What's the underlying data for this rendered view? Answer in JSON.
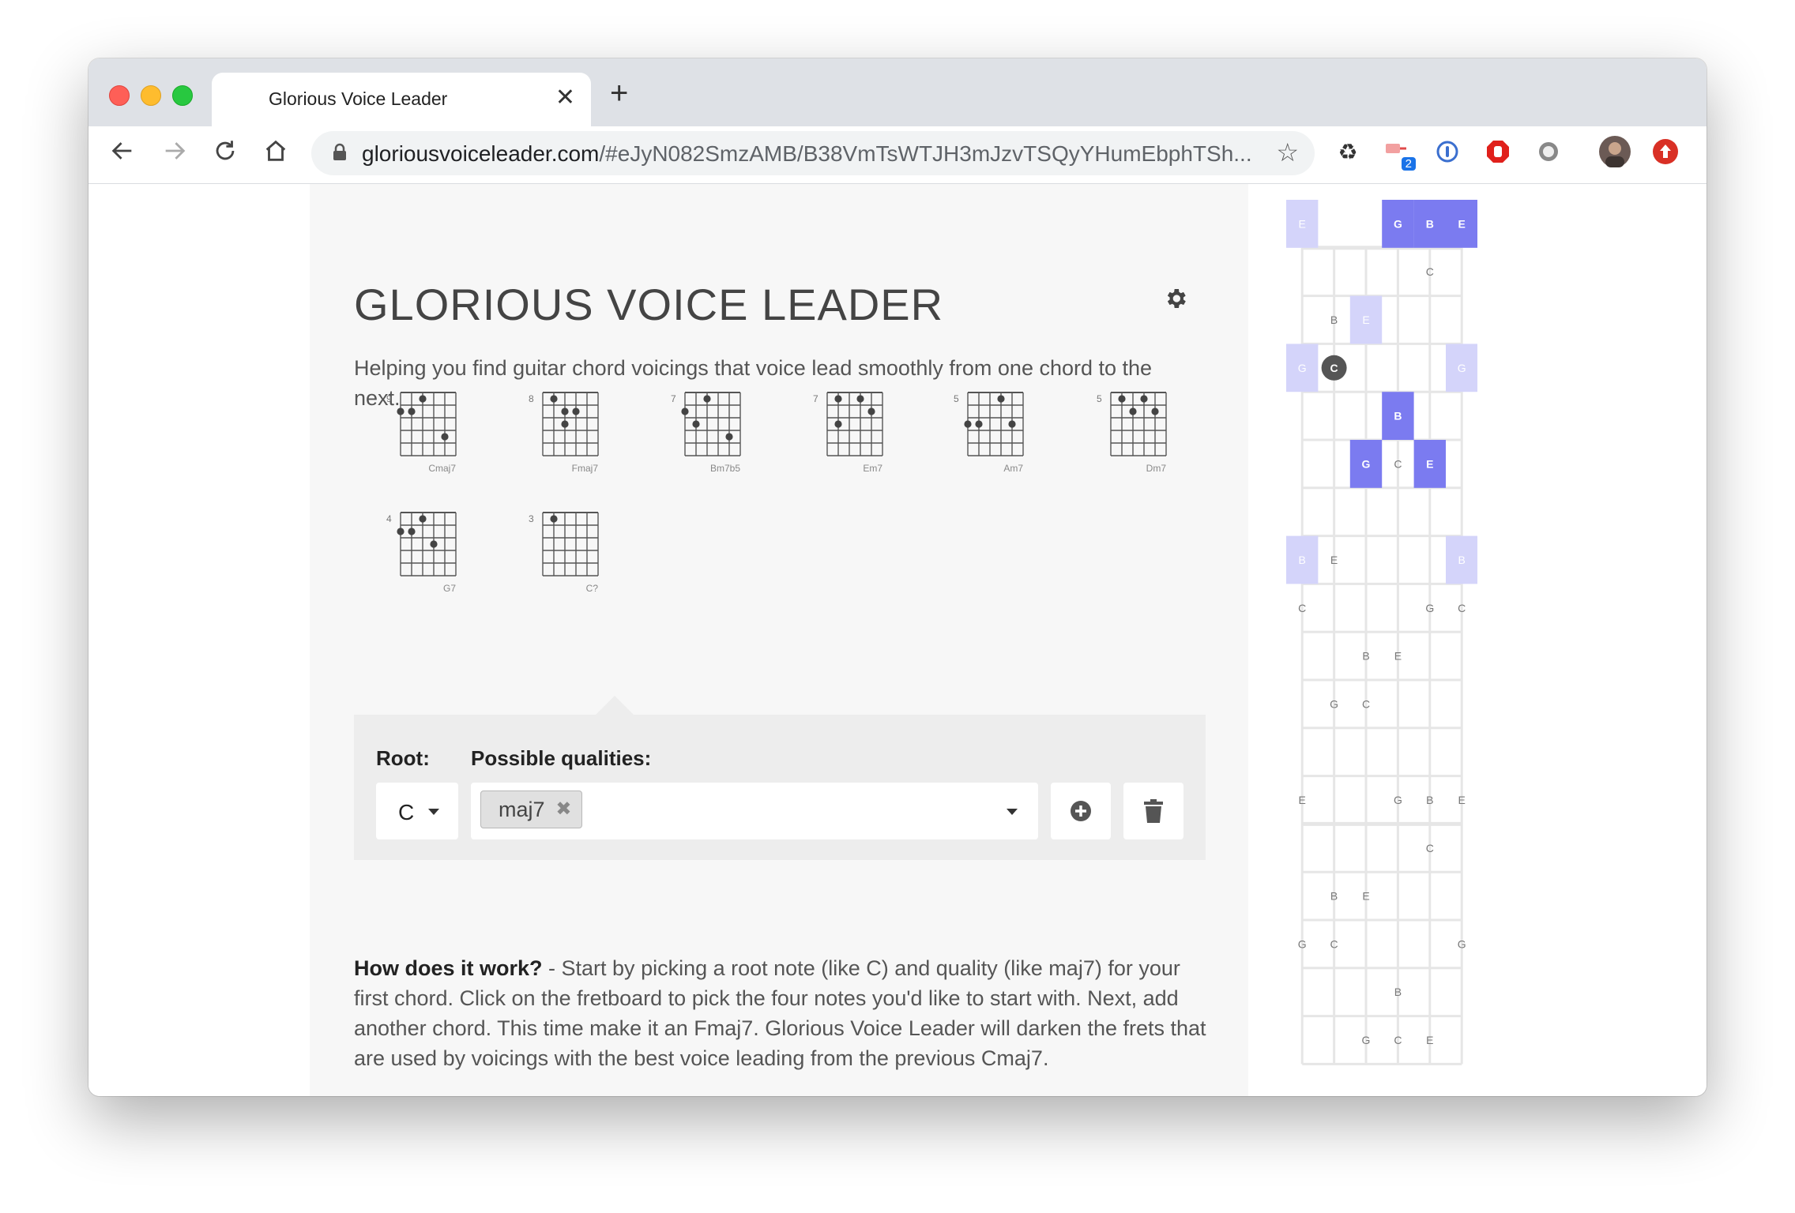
{
  "browser": {
    "tab_title": "Glorious Voice Leader",
    "tab_close": "✕",
    "new_tab": "+",
    "url_host": "gloriousvoiceleader.com",
    "url_rest": "/#eJyN082SmzAMB/B38VmTsWTJH3mJzvTSQyYHumEbphTSh...",
    "extension_badge": "2"
  },
  "app": {
    "title": "GLORIOUS VOICE LEADER",
    "subtitle": "Helping you find guitar chord voicings that voice lead smoothly from one chord to the next."
  },
  "chords": [
    {
      "name": "Cmaj7",
      "fret": "9",
      "dots": [
        [
          1,
          0
        ],
        [
          1,
          1
        ],
        [
          0,
          2
        ],
        [
          3,
          4
        ]
      ]
    },
    {
      "name": "Fmaj7",
      "fret": "8",
      "dots": [
        [
          0,
          1
        ],
        [
          1,
          2
        ],
        [
          2,
          2
        ],
        [
          1,
          3
        ]
      ]
    },
    {
      "name": "Bm7b5",
      "fret": "7",
      "dots": [
        [
          1,
          0
        ],
        [
          0,
          2
        ],
        [
          2,
          1
        ],
        [
          3,
          4
        ]
      ]
    },
    {
      "name": "Em7",
      "fret": "7",
      "dots": [
        [
          0,
          1
        ],
        [
          2,
          1
        ],
        [
          0,
          3
        ],
        [
          1,
          4
        ]
      ]
    },
    {
      "name": "Am7",
      "fret": "5",
      "dots": [
        [
          2,
          0
        ],
        [
          2,
          1
        ],
        [
          0,
          3
        ],
        [
          2,
          4
        ]
      ]
    },
    {
      "name": "Dm7",
      "fret": "5",
      "dots": [
        [
          0,
          1
        ],
        [
          1,
          2
        ],
        [
          0,
          3
        ],
        [
          1,
          4
        ]
      ]
    },
    {
      "name": "G7",
      "fret": "4",
      "dots": [
        [
          1,
          0
        ],
        [
          1,
          1
        ],
        [
          0,
          2
        ],
        [
          2,
          3
        ]
      ]
    },
    {
      "name": "C?",
      "fret": "3",
      "dots": [
        [
          0,
          1
        ]
      ]
    }
  ],
  "quality_panel": {
    "root_label": "Root:",
    "qualities_label": "Possible qualities:",
    "root_value": "C",
    "quality_chip": "maj7",
    "chip_remove": "✖"
  },
  "help": {
    "heading": "How does it work?",
    "body": " - Start by picking a root note (like C) and quality (like maj7) for your first chord. Click on the fretboard to pick the four notes you'd like to start with. Next, add another chord. This time make it an Fmaj7. Glorious Voice Leader will darken the frets that are used by voicings with the best voice leading from the previous Cmaj7."
  },
  "fretboard": {
    "rows": [
      [
        "E",
        "",
        "",
        "G",
        "B",
        "E"
      ],
      [
        "",
        "",
        "",
        "",
        "C",
        ""
      ],
      [
        "",
        "B",
        "E",
        "",
        "",
        ""
      ],
      [
        "G",
        "C",
        "",
        "",
        "",
        "G"
      ],
      [
        "",
        "",
        "",
        "B",
        "",
        ""
      ],
      [
        "",
        "",
        "G",
        "C",
        "E",
        ""
      ],
      [
        "",
        "",
        "",
        "",
        "",
        ""
      ],
      [
        "B",
        "E",
        "",
        "",
        "",
        "B"
      ],
      [
        "C",
        "",
        "",
        "",
        "G",
        "C"
      ],
      [
        "",
        "",
        "B",
        "E",
        "",
        ""
      ],
      [
        "",
        "G",
        "C",
        "",
        "",
        ""
      ],
      [
        "",
        "",
        "",
        "",
        "",
        ""
      ],
      [
        "E",
        "",
        "",
        "G",
        "B",
        "E"
      ],
      [
        "",
        "",
        "",
        "",
        "C",
        ""
      ],
      [
        "",
        "B",
        "E",
        "",
        "",
        ""
      ],
      [
        "G",
        "C",
        "",
        "",
        "",
        "G"
      ],
      [
        "",
        "",
        "",
        "B",
        "",
        ""
      ],
      [
        "",
        "",
        "G",
        "C",
        "E",
        ""
      ]
    ],
    "highlights_dark": [
      [
        0,
        3
      ],
      [
        0,
        4
      ],
      [
        0,
        5
      ],
      [
        4,
        3
      ],
      [
        5,
        2
      ],
      [
        5,
        4
      ]
    ],
    "highlights_light": [
      [
        0,
        0
      ],
      [
        2,
        2
      ],
      [
        3,
        0
      ],
      [
        3,
        5
      ],
      [
        7,
        0
      ],
      [
        7,
        5
      ]
    ],
    "highlights_medium": [
      [
        7,
        0
      ]
    ],
    "selected": [
      [
        3,
        1
      ]
    ],
    "colors": {
      "dark": "#7b7bf0",
      "light": "#d4d4fa",
      "selected": "#555555",
      "text": "#777777"
    }
  }
}
